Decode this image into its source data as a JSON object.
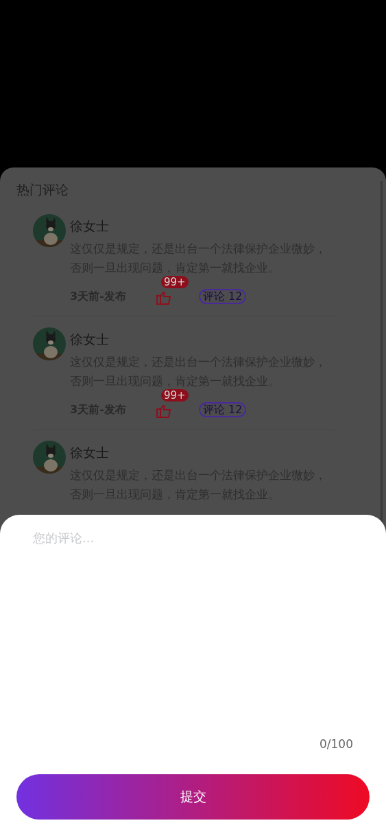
{
  "comments_panel": {
    "title": "热门评论",
    "comments": [
      {
        "author": "徐女士",
        "text": "这仅仅是规定，还是出台一个法律保护企业微妙，否则一旦出现问题，肯定第一就找企业。",
        "time": "3天前-发布",
        "like_badge": "99+",
        "reply_label": "评论 12"
      },
      {
        "author": "徐女士",
        "text": "这仅仅是规定，还是出台一个法律保护企业微妙，否则一旦出现问题，肯定第一就找企业。",
        "time": "3天前-发布",
        "like_badge": "99+",
        "reply_label": "评论 12"
      },
      {
        "author": "徐女士",
        "text": "这仅仅是规定，还是出台一个法律保护企业微妙，否则一旦出现问题，肯定第一就找企业。"
      }
    ]
  },
  "comment_sheet": {
    "placeholder": "您的评论...",
    "counter": "0/100",
    "submit_label": "提交"
  }
}
